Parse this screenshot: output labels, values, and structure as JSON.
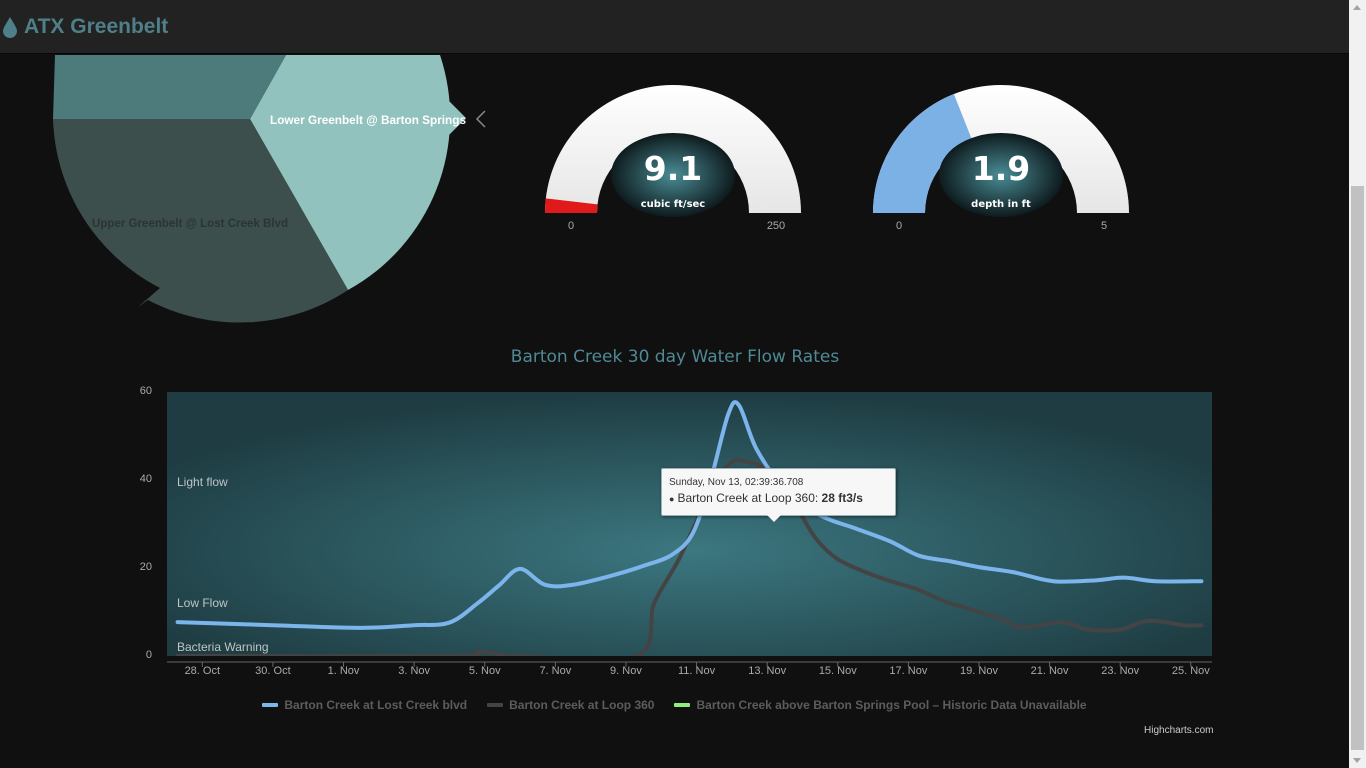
{
  "app": {
    "title": "ATX Greenbelt",
    "icon": "water-drop-icon",
    "brand_color": "#4f7f89"
  },
  "pie": {
    "labels": [
      "Lower Greenbelt @ Barton Springs",
      "Upper Greenbelt @ Lost Creek Blvd"
    ]
  },
  "gauges": [
    {
      "value": "9.1",
      "numeric": 9.1,
      "unit": "cubic ft/sec",
      "min": "0",
      "max": "250",
      "min_num": 0,
      "max_num": 250,
      "color": "#e01a1a"
    },
    {
      "value": "1.9",
      "numeric": 1.9,
      "unit": "depth in ft",
      "min": "0",
      "max": "5",
      "min_num": 0,
      "max_num": 5,
      "color": "#7cb1e6"
    }
  ],
  "chart_data": {
    "type": "line",
    "title": "Barton Creek 30 day Water Flow Rates",
    "xlabel": "",
    "ylabel": "",
    "ylim": [
      0,
      60
    ],
    "y_ticks": [
      "0",
      "20",
      "40",
      "60"
    ],
    "x_ticks": [
      "28. Oct",
      "30. Oct",
      "1. Nov",
      "3. Nov",
      "5. Nov",
      "7. Nov",
      "9. Nov",
      "11. Nov",
      "13. Nov",
      "15. Nov",
      "17. Nov",
      "19. Nov",
      "21. Nov",
      "23. Nov",
      "25. Nov"
    ],
    "x_tick_days": [
      1,
      3,
      5,
      7,
      9,
      11,
      13,
      15,
      17,
      19,
      21,
      23,
      25,
      27,
      29
    ],
    "x_range_days": [
      0,
      29.6
    ],
    "plot_bands": [
      "Light flow",
      "Low Flow",
      "Bacteria Warning"
    ],
    "grid": false,
    "legend": "bottom-center",
    "series": [
      {
        "name": "Barton Creek at Lost Creek blvd",
        "color": "#7cb5ec",
        "points": [
          [
            0.3,
            7.7
          ],
          [
            3,
            7
          ],
          [
            5.5,
            6.4
          ],
          [
            7,
            7
          ],
          [
            8,
            7.6
          ],
          [
            8.8,
            12
          ],
          [
            9.4,
            16
          ],
          [
            10,
            19.8
          ],
          [
            10.7,
            16.2
          ],
          [
            11.5,
            16.2
          ],
          [
            12.7,
            18.5
          ],
          [
            13.5,
            20.5
          ],
          [
            14.3,
            23
          ],
          [
            14.9,
            28
          ],
          [
            15.4,
            40
          ],
          [
            15.9,
            55
          ],
          [
            16.2,
            57
          ],
          [
            16.7,
            47
          ],
          [
            17.5,
            38
          ],
          [
            18.5,
            32
          ],
          [
            19.5,
            29
          ],
          [
            20.5,
            26
          ],
          [
            21.3,
            22.8
          ],
          [
            22.2,
            21.5
          ],
          [
            23,
            20.2
          ],
          [
            24,
            19
          ],
          [
            25.1,
            17
          ],
          [
            26.3,
            17.2
          ],
          [
            27.1,
            17.8
          ],
          [
            28,
            17
          ],
          [
            29.3,
            17
          ]
        ]
      },
      {
        "name": "Barton Creek at Loop 360",
        "color": "#444444",
        "points": [
          [
            0.3,
            0
          ],
          [
            8,
            0
          ],
          [
            8.8,
            1
          ],
          [
            9.3,
            0.5
          ],
          [
            10,
            0
          ],
          [
            13.3,
            0
          ],
          [
            13.8,
            12
          ],
          [
            14.5,
            22
          ],
          [
            15.2,
            34
          ],
          [
            15.9,
            43.5
          ],
          [
            16.5,
            44
          ],
          [
            17.3,
            41
          ],
          [
            17.9,
            33
          ],
          [
            18.4,
            26.5
          ],
          [
            19,
            22
          ],
          [
            19.8,
            19
          ],
          [
            20.5,
            17
          ],
          [
            21.3,
            15
          ],
          [
            22,
            12.5
          ],
          [
            22.8,
            10.5
          ],
          [
            23.6,
            8.5
          ],
          [
            24.2,
            6.5
          ],
          [
            25.1,
            7.5
          ],
          [
            25.5,
            7.5
          ],
          [
            26.1,
            6
          ],
          [
            27,
            6
          ],
          [
            27.8,
            8
          ],
          [
            28.8,
            7
          ],
          [
            29.3,
            7
          ]
        ]
      },
      {
        "name": "Barton Creek above Barton Springs Pool – Historic Data Unavailable",
        "color": "#90ed7d",
        "points": []
      }
    ],
    "tooltip": {
      "date": "Sunday, Nov 13, 02:39:36.708",
      "series": "Barton Creek at Loop 360",
      "value": "28 ft3/s"
    },
    "credits": "Highcharts.com"
  }
}
